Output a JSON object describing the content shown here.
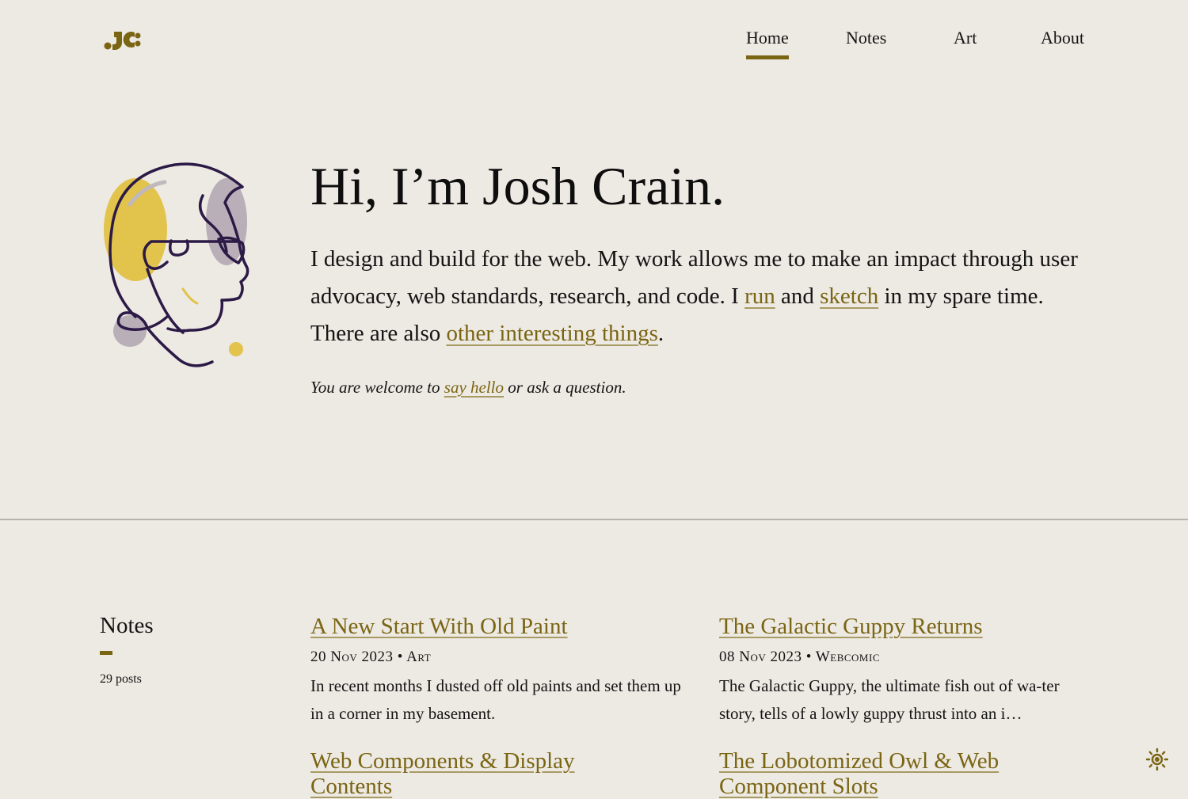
{
  "brand": {
    "logo_text": "JC",
    "accent": "#7a6513"
  },
  "nav": {
    "items": [
      {
        "label": "Home",
        "active": true
      },
      {
        "label": "Notes",
        "active": false
      },
      {
        "label": "Art",
        "active": false
      },
      {
        "label": "About",
        "active": false
      }
    ]
  },
  "hero": {
    "title": "Hi, I’m Josh Crain.",
    "text_1": "I design and build for the web. My work allows me to make an impact through user advocacy, web standards, research, and code. I ",
    "link_run": "run",
    "text_2": " and ",
    "link_sketch": "sketch",
    "text_3": " in my spare time. There are also ",
    "link_other": "other interesting things",
    "text_4": ".",
    "sub_1": "You are welcome to ",
    "sub_link": "say hello",
    "sub_2": " or ask a question."
  },
  "notes": {
    "title": "Notes",
    "count": "29 posts",
    "posts": [
      {
        "title": "A New Start With Old Paint",
        "date": "20 Nov 2023",
        "category": "Art",
        "excerpt": "In recent months I dusted off old paints and set them up in a corner in my basement."
      },
      {
        "title": "The Galactic Guppy Returns",
        "date": "08 Nov 2023",
        "category": "Webcomic",
        "excerpt": "The Galactic Guppy, the ultimate fish out of wa-ter story, tells of a lowly guppy thrust into an i…"
      },
      {
        "title": "Web Components & Display Contents",
        "date": "",
        "category": "",
        "excerpt": ""
      },
      {
        "title": "The Lobotomized Owl & Web Component Slots",
        "date": "",
        "category": "",
        "excerpt": ""
      }
    ],
    "meta_separator": "•"
  },
  "theme_toggle": {
    "icon": "sun-icon"
  }
}
